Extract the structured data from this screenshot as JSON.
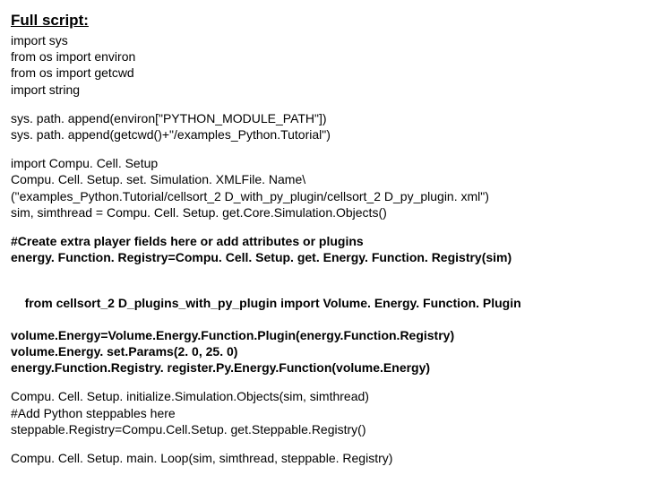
{
  "heading": "Full script:",
  "block1": [
    "import sys",
    "from os import environ",
    "from os import getcwd",
    "import string"
  ],
  "block2": [
    "sys. path. append(environ[\"PYTHON_MODULE_PATH\"])",
    "sys. path. append(getcwd()+\"/examples_Python.Tutorial\")"
  ],
  "block3": [
    "import Compu. Cell. Setup",
    "Compu. Cell. Setup. set. Simulation. XMLFile. Name\\",
    "(\"examples_Python.Tutorial/cellsort_2 D_with_py_plugin/cellsort_2 D_py_plugin. xml\")",
    "sim, simthread = Compu. Cell. Setup. get.Core.Simulation.Objects()"
  ],
  "block4": [
    "#Create extra player fields here or add attributes or plugins",
    "energy. Function. Registry=Compu. Cell. Setup. get. Energy. Function. Registry(sim)"
  ],
  "block5_prefix": "from ",
  "block5_mid": "cellsort_2 D_plugins_with_py_plugin ",
  "block5_import": "import ",
  "block5_end": "Volume. Energy. Function. Plugin",
  "block5_rest": [
    "volume.Energy=Volume.Energy.Function.Plugin(energy.Function.Registry)",
    "volume.Energy. set.Params(2. 0, 25. 0)",
    "energy.Function.Registry. register.Py.Energy.Function(volume.Energy)"
  ],
  "block6": [
    "Compu. Cell. Setup. initialize.Simulation.Objects(sim, simthread)",
    "#Add Python steppables here",
    "steppable.Registry=Compu.Cell.Setup. get.Steppable.Registry()"
  ],
  "block7": [
    "Compu. Cell. Setup. main. Loop(sim, simthread, steppable. Registry)"
  ]
}
